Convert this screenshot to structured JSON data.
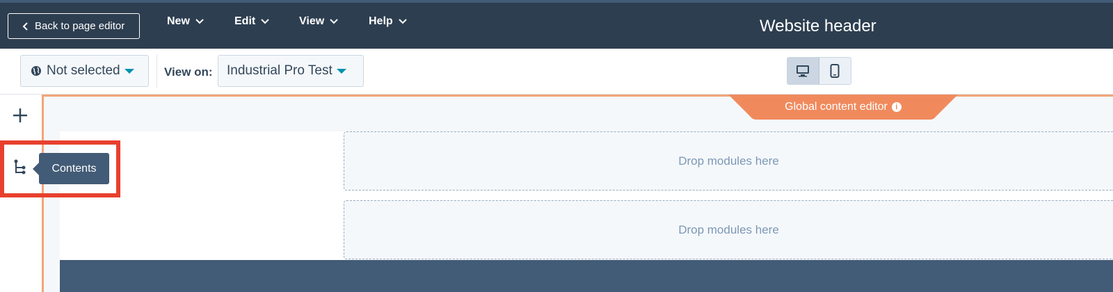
{
  "topbar": {
    "back_label": "Back to page editor",
    "menus": [
      "New",
      "Edit",
      "View",
      "Help"
    ],
    "title": "Website header"
  },
  "subbar": {
    "language_value": "Not selected",
    "view_on_label": "View on:",
    "view_on_value": "Industrial Pro Test",
    "device_active": "desktop"
  },
  "sidebar": {
    "tooltip": "Contents",
    "icons": [
      "plus-icon",
      "tree-icon"
    ]
  },
  "canvas": {
    "global_editor_label": "Global content editor",
    "drop_zones": [
      "Drop modules here",
      "Drop modules here"
    ]
  },
  "colors": {
    "topbar": "#2d3e50",
    "accent_orange": "#f08a5d",
    "highlight_red": "#e8402e",
    "tooltip": "#425b76"
  }
}
